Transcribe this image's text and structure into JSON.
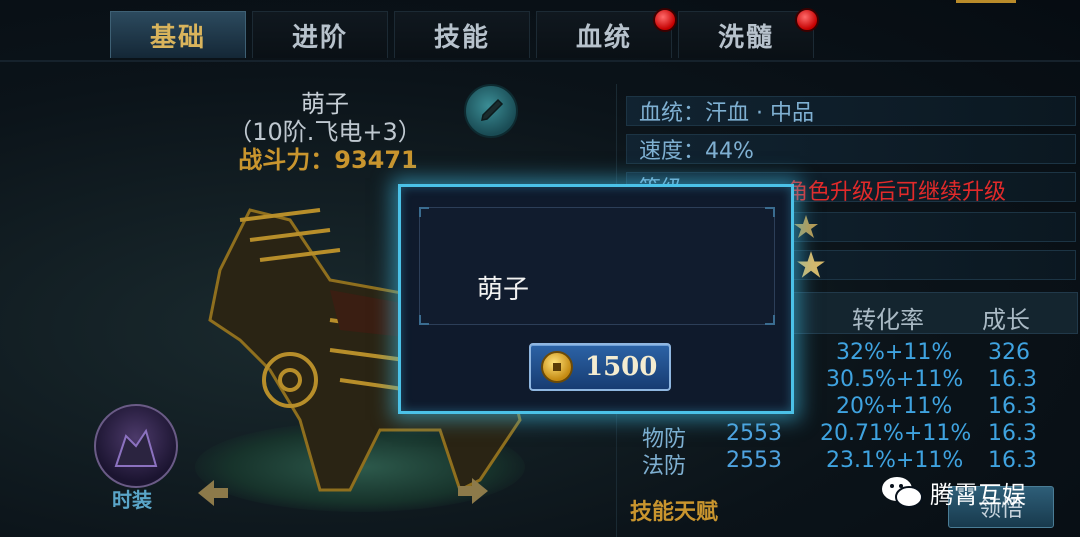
{
  "tabs": [
    {
      "label": "基础",
      "active": true,
      "badge": false
    },
    {
      "label": "进阶",
      "active": false,
      "badge": false
    },
    {
      "label": "技能",
      "active": false,
      "badge": false
    },
    {
      "label": "血统",
      "active": false,
      "badge": true
    },
    {
      "label": "洗髓",
      "active": false,
      "badge": true
    }
  ],
  "mount": {
    "name": "萌子",
    "rank": "（10阶.飞电+3）",
    "power_label": "战斗力：",
    "power_value": "93471"
  },
  "costume_label": "时装",
  "info_rows": {
    "bloodline": "血统：汗血 · 中品",
    "speed": "速度：44%",
    "level_partial": "等级",
    "level_note": "角色升级后可继续升级"
  },
  "stat_table": {
    "headers": [
      "转化率",
      "成长"
    ],
    "rows": [
      {
        "name": "",
        "value": "",
        "rate": "32%+11%",
        "growth": "326"
      },
      {
        "name": "",
        "value": "",
        "rate": "30.5%+11%",
        "growth": "16.3"
      },
      {
        "name": "",
        "value": "",
        "rate": "20%+11%",
        "growth": "16.3"
      },
      {
        "name": "物防",
        "value": "2553",
        "rate": "20.71%+11%",
        "growth": "16.3"
      },
      {
        "name": "法防",
        "value": "2553",
        "rate": "23.1%+11%",
        "growth": "16.3"
      }
    ]
  },
  "skill_talent_title": "技能天赋",
  "claim_button": "领悟",
  "watermark": "腾霄互娱",
  "rename_dialog": {
    "input_value": "萌子",
    "cost": "1500"
  },
  "colors": {
    "modal_border": "#4bc2e8",
    "gold": "#c9952e",
    "warning_red": "#e22a2a",
    "stat_blue": "#3fa3e0"
  }
}
